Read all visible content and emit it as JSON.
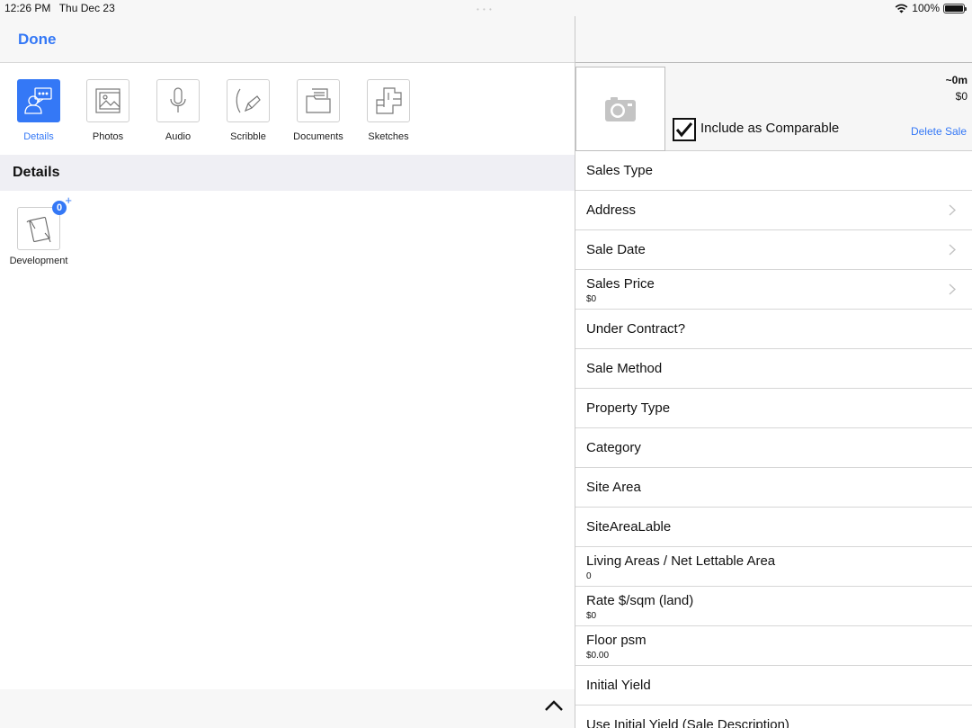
{
  "status": {
    "time": "12:26 PM",
    "date": "Thu Dec 23",
    "battery": "100%"
  },
  "left": {
    "done_label": "Done",
    "tools": [
      {
        "label": "Details",
        "icon": "details-chat-icon",
        "active": true
      },
      {
        "label": "Photos",
        "icon": "photos-icon"
      },
      {
        "label": "Audio",
        "icon": "microphone-icon"
      },
      {
        "label": "Scribble",
        "icon": "pen-icon"
      },
      {
        "label": "Documents",
        "icon": "folder-icon"
      },
      {
        "label": "Sketches",
        "icon": "floorplan-icon"
      }
    ],
    "section_title": "Details",
    "items": [
      {
        "label": "Development",
        "badge": "0",
        "icon": "tablet-hand-icon"
      }
    ]
  },
  "right": {
    "include_label": "Include as Comparable",
    "include_checked": true,
    "time_label": "~0m",
    "price_label": "$0",
    "delete_label": "Delete Sale",
    "rows": [
      {
        "title": "Sales Type"
      },
      {
        "title": "Address",
        "chevron": true
      },
      {
        "title": "Sale Date",
        "chevron": true
      },
      {
        "title": "Sales Price",
        "sub": "$0",
        "chevron": true
      },
      {
        "title": "Under Contract?"
      },
      {
        "title": "Sale Method"
      },
      {
        "title": "Property Type"
      },
      {
        "title": "Category"
      },
      {
        "title": "Site Area"
      },
      {
        "title": "SiteAreaLable"
      },
      {
        "title": "Living Areas / Net Lettable Area",
        "sub": "0"
      },
      {
        "title": "Rate $/sqm (land)",
        "sub": "$0"
      },
      {
        "title": "Floor psm",
        "sub": "$0.00"
      },
      {
        "title": "Initial Yield"
      },
      {
        "title": "Use Initial Yield (Sale Description)"
      }
    ]
  },
  "colors": {
    "accent": "#3478f6"
  }
}
